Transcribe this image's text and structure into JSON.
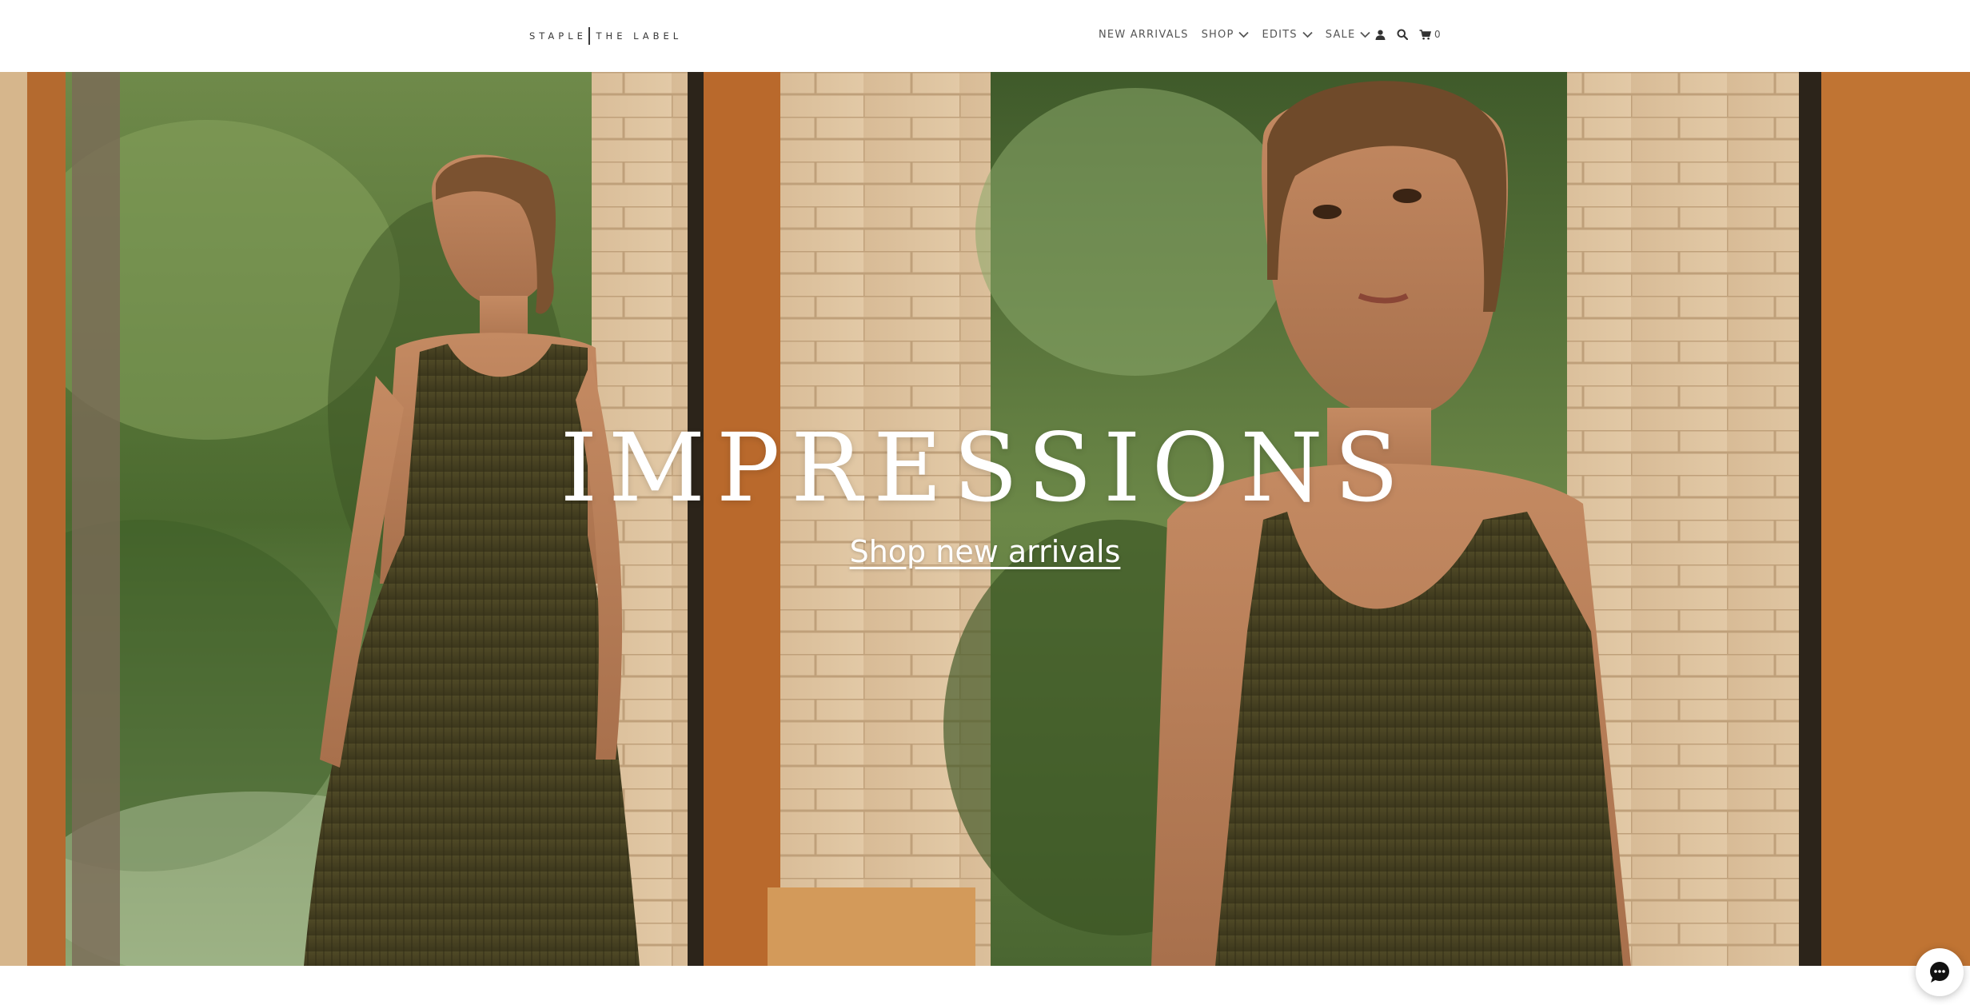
{
  "header": {
    "logo_left": "STAPLE",
    "logo_right": "THE LABEL",
    "nav": [
      {
        "label": "NEW ARRIVALS",
        "has_dropdown": false
      },
      {
        "label": "SHOP",
        "has_dropdown": true
      },
      {
        "label": "EDITS",
        "has_dropdown": true
      },
      {
        "label": "SALE",
        "has_dropdown": true
      }
    ],
    "icons": [
      "user-icon",
      "search-icon",
      "cart-icon"
    ],
    "cart_count": "0"
  },
  "hero": {
    "title": "IMPRESSIONS",
    "link_label": "Shop new arrivals"
  },
  "chat_widget": {
    "icon": "chat-bubble-icon"
  },
  "colors": {
    "nav_text": "#555555",
    "logo_text": "#3a3a3a",
    "dress": "#4a4523",
    "foliage": "#4f6b34",
    "brick": "#d7b890",
    "wood_frame": "#b5682c"
  }
}
